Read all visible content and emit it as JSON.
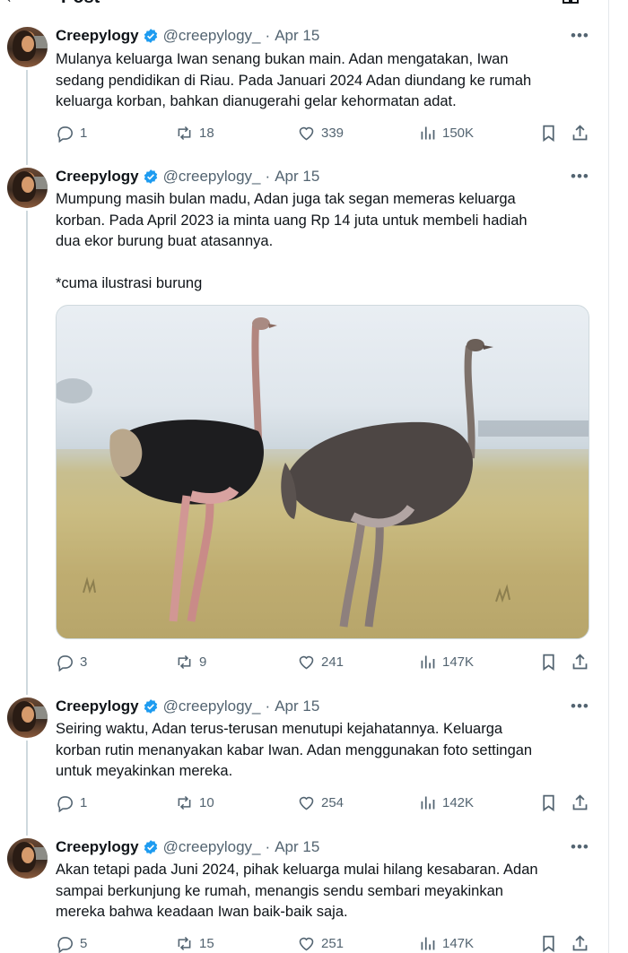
{
  "header": {
    "back_glyph": "←",
    "title": "Post",
    "action_icon": "book-icon"
  },
  "colors": {
    "text": "#0f1419",
    "muted": "#536471",
    "verified": "#1d9bf0",
    "thread_line": "#cfd9de"
  },
  "tweets": [
    {
      "name": "Creepylogy",
      "handle": "@creepylogy_",
      "date": "Apr 15",
      "lines": [
        "Mulanya keluarga Iwan senang bukan main. Adan mengatakan, Iwan",
        "sedang pendidikan di Riau. Pada Januari 2024 Adan diundang ke rumah",
        "keluarga korban, bahkan dianugerahi gelar kehormatan adat."
      ],
      "replies": "1",
      "reposts": "18",
      "likes": "339",
      "views": "150K"
    },
    {
      "name": "Creepylogy",
      "handle": "@creepylogy_",
      "date": "Apr 15",
      "lines": [
        "Mumpung masih bulan madu, Adan juga tak segan memeras keluarga",
        "korban. Pada April 2023 ia minta uang Rp 14 juta untuk membeli hadiah",
        "dua ekor burung buat atasannya."
      ],
      "extra_line": "*cuma ilustrasi burung",
      "replies": "3",
      "reposts": "9",
      "likes": "241",
      "views": "147K"
    },
    {
      "name": "Creepylogy",
      "handle": "@creepylogy_",
      "date": "Apr 15",
      "lines": [
        "Seiring waktu, Adan terus-terusan menutupi kejahatannya. Keluarga",
        "korban rutin menanyakan kabar Iwan. Adan menggunakan foto settingan",
        "untuk meyakinkan mereka."
      ],
      "replies": "1",
      "reposts": "10",
      "likes": "254",
      "views": "142K"
    },
    {
      "name": "Creepylogy",
      "handle": "@creepylogy_",
      "date": "Apr 15",
      "lines": [
        "Akan tetapi pada Juni 2024, pihak keluarga mulai hilang kesabaran. Adan",
        "sampai berkunjung ke rumah, menangis sendu sembari meyakinkan",
        "mereka bahwa keadaan Iwan baik-baik saja."
      ],
      "replies": "5",
      "reposts": "15",
      "likes": "251",
      "views": "147K"
    }
  ]
}
